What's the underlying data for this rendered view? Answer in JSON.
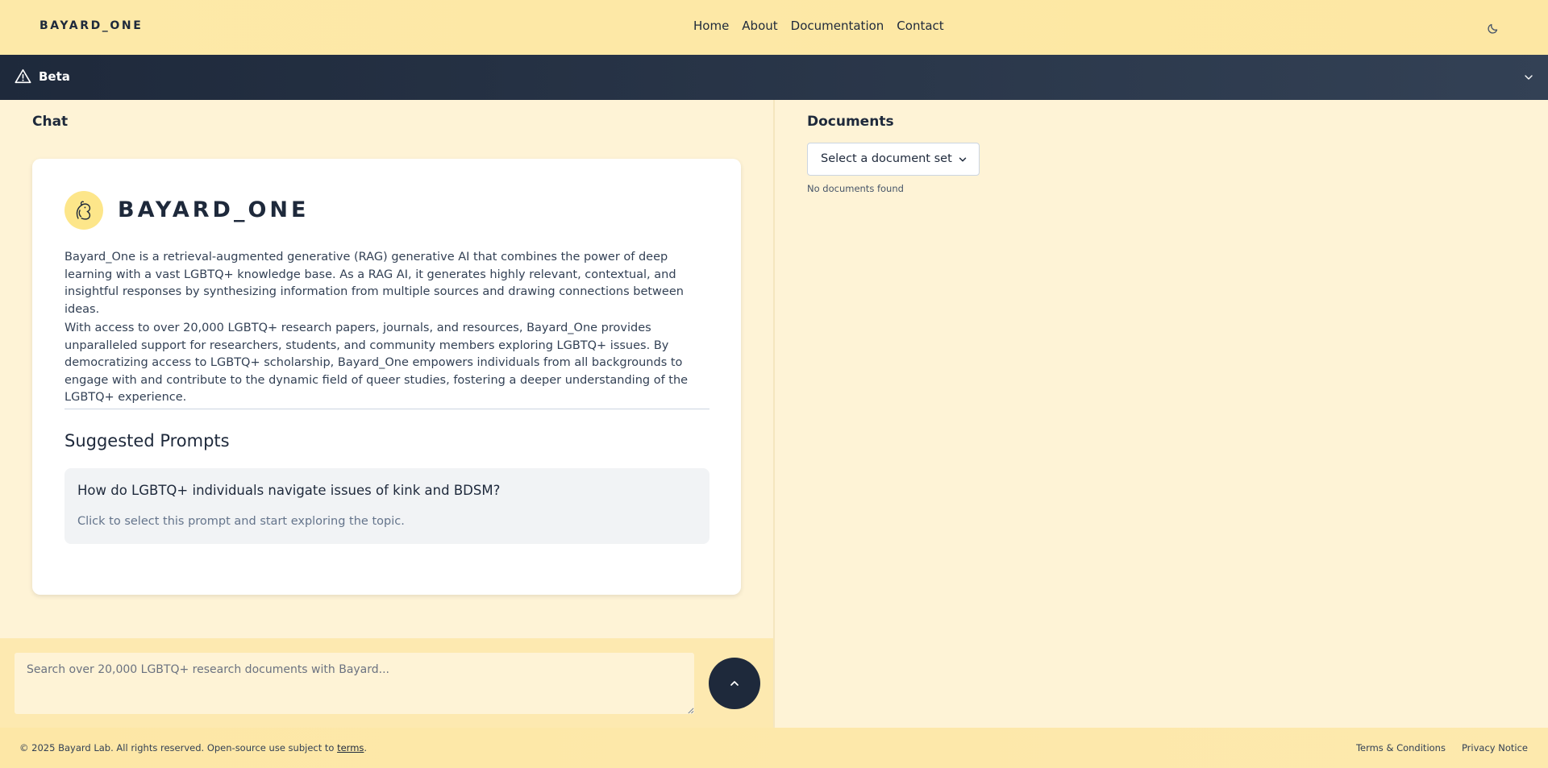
{
  "header": {
    "brand": "BAYARD_ONE",
    "nav": [
      "Home",
      "About",
      "Documentation",
      "Contact"
    ],
    "theme_icon": "moon-icon"
  },
  "beta": {
    "label": "Beta",
    "icon": "warning-triangle-icon",
    "toggle_icon": "chevron-down-icon"
  },
  "chat": {
    "title": "Chat",
    "logo_icon": "squirrel-icon",
    "logo_text": "BAYARD_ONE",
    "paragraphs": [
      "Bayard_One is a retrieval-augmented generative (RAG) generative AI that combines the power of deep learning with a vast LGBTQ+ knowledge base. As a RAG AI, it generates highly relevant, contextual, and insightful responses by synthesizing information from multiple sources and drawing connections between ideas.",
      "With access to over 20,000 LGBTQ+ research papers, journals, and resources, Bayard_One provides unparalleled support for researchers, students, and community members exploring LGBTQ+ issues. By democratizing access to LGBTQ+ scholarship, Bayard_One empowers individuals from all backgrounds to engage with and contribute to the dynamic field of queer studies, fostering a deeper understanding of the LGBTQ+ experience."
    ],
    "suggested_title": "Suggested Prompts",
    "prompts": [
      {
        "title": "How do LGBTQ+ individuals navigate issues of kink and BDSM?",
        "subtitle": "Click to select this prompt and start exploring the topic."
      }
    ],
    "input_placeholder": "Search over 20,000 LGBTQ+ research documents with Bayard...",
    "send_icon": "chevron-up-icon"
  },
  "documents": {
    "title": "Documents",
    "select_label": "Select a document set",
    "empty_text": "No documents found"
  },
  "footer": {
    "copyright_prefix": "© 2025 Bayard Lab. All rights reserved. Open-source use subject to ",
    "terms_link": "terms",
    "copyright_suffix": ".",
    "links": [
      "Terms & Conditions",
      "Privacy Notice"
    ]
  },
  "colors": {
    "header_bg": "#fde9a8",
    "beta_bg": "#1e293b",
    "page_bg": "#fef3d6",
    "accent_dark": "#1e293b",
    "logo_circle": "#fde68a"
  }
}
